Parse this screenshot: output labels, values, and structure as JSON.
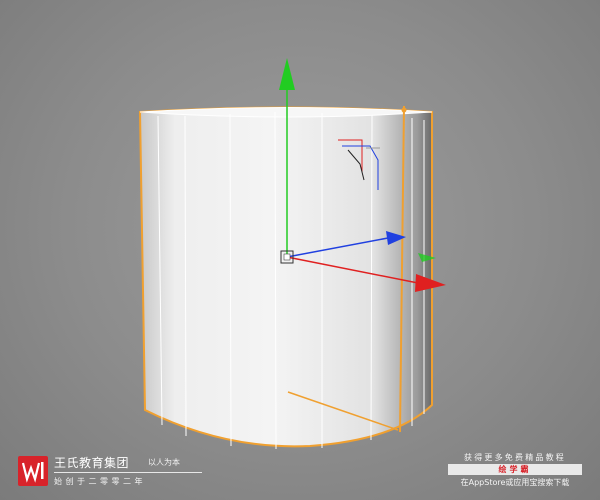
{
  "viewport": {
    "background": "#8f8f8f",
    "object_fill": "#e9e9e9",
    "selection_outline_color": "#f0a030",
    "axis_colors": {
      "y": "#22cc22",
      "x": "#e02020",
      "z": "#2040e0"
    }
  },
  "watermark": {
    "brand_name": "王氏教育集团",
    "slogan": "以人为本",
    "founded": "始创于二零零二年",
    "logo_color": "#d8232a"
  },
  "promo": {
    "line1": "获得更多免费精品教程",
    "app_name": "绘学霸",
    "line3": "在AppStore或应用宝搜索下载"
  },
  "icons": [
    "logo-mark-icon",
    "axis-gizmo-icon",
    "view-orientation-icon"
  ]
}
